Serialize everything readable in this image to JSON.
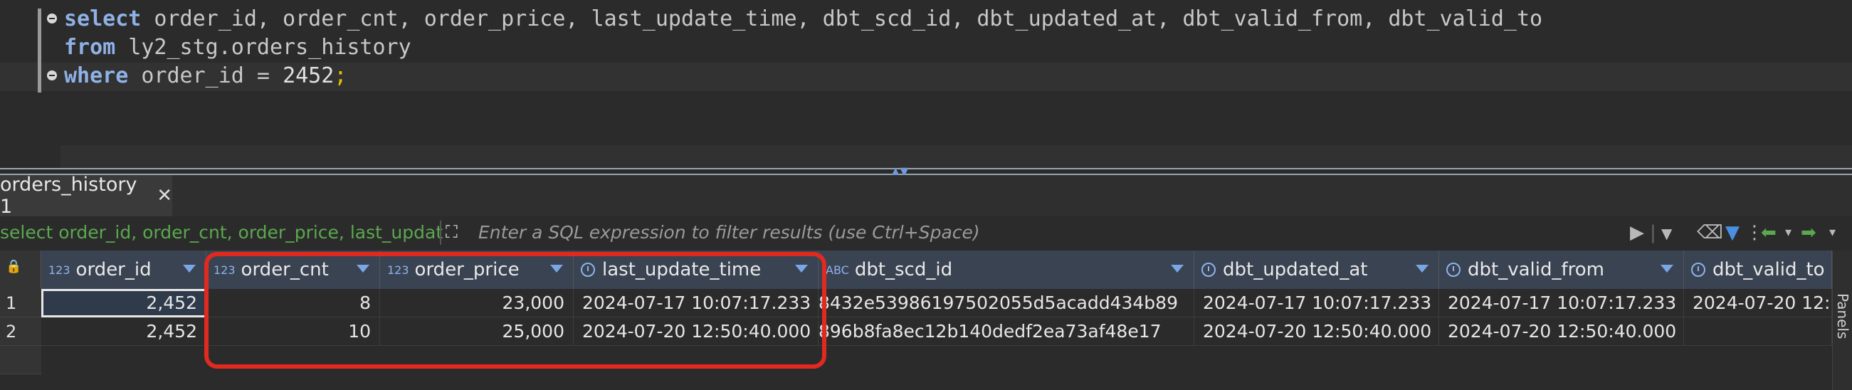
{
  "editor": {
    "line1": {
      "kw": "select",
      "rest": " order_id, order_cnt, order_price, last_update_time, dbt_scd_id, dbt_updated_at, dbt_valid_from, dbt_valid_to"
    },
    "line2": {
      "kw": "from",
      "rest": " ly2_stg.orders_history"
    },
    "line3": {
      "kw": "where",
      "rest": " order_id = ",
      "num": "2452",
      "semi": ";"
    }
  },
  "results_tab": {
    "label": "orders_history 1",
    "close": "✕"
  },
  "filter": {
    "sql_preview": "select order_id, order_cnt, order_price, last_updat",
    "placeholder": "Enter a SQL expression to filter results (use Ctrl+Space)"
  },
  "grid": {
    "columns": [
      {
        "name": "order_id",
        "type": "123"
      },
      {
        "name": "order_cnt",
        "type": "123"
      },
      {
        "name": "order_price",
        "type": "123"
      },
      {
        "name": "last_update_time",
        "type": "clock-icon"
      },
      {
        "name": "dbt_scd_id",
        "type": "ABC"
      },
      {
        "name": "dbt_updated_at",
        "type": "clock-icon"
      },
      {
        "name": "dbt_valid_from",
        "type": "clock-icon"
      },
      {
        "name": "dbt_valid_to",
        "type": "clock-icon"
      }
    ],
    "rows": [
      {
        "num": "1",
        "cells": [
          "2,452",
          "8",
          "23,000",
          "2024-07-17 10:07:17.233",
          "8432e53986197502055d5acadd434b89",
          "2024-07-17 10:07:17.233",
          "2024-07-17 10:07:17.233",
          "2024-07-20 12:5"
        ]
      },
      {
        "num": "2",
        "cells": [
          "2,452",
          "10",
          "25,000",
          "2024-07-20 12:50:40.000",
          "896b8fa8ec12b140dedf2ea73af48e17",
          "2024-07-20 12:50:40.000",
          "2024-07-20 12:50:40.000",
          ""
        ]
      }
    ]
  },
  "side_panel": {
    "label": "Panels"
  },
  "colors": {
    "highlight": "#e02a1f",
    "keyword": "#8fb1e6",
    "filter_sql": "#5aa84e"
  }
}
